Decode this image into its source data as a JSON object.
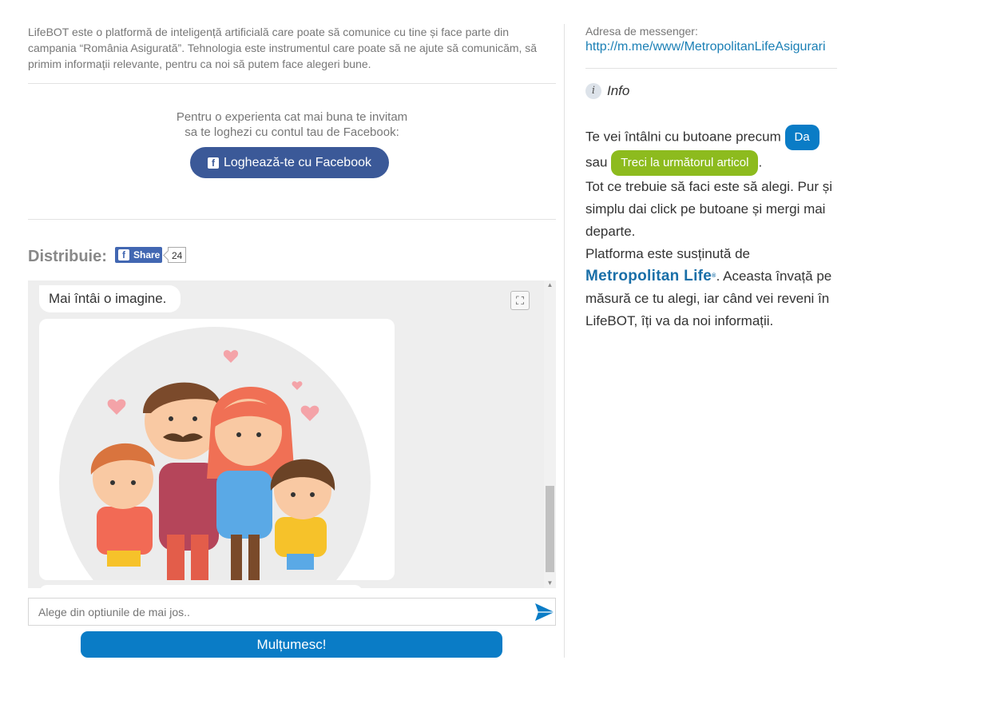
{
  "intro_text": "LifeBOT este o platformă de inteligență artificială care poate să comunice cu tine și face parte din campania “România Asigurată”. Tehnologia este instrumentul care poate să ne ajute să comunicăm, să primim informații relevante, pentru ca noi să putem face alegeri bune.",
  "login": {
    "invite_line1": "Pentru o experienta cat mai buna te invitam",
    "invite_line2": "sa te loghezi cu contul tau de Facebook:",
    "button_label": "Loghează-te cu Facebook",
    "icon": "facebook-icon"
  },
  "share": {
    "label": "Distribuie:",
    "button_label": "Share",
    "count": "24"
  },
  "chat": {
    "first_message": "Mai întâi o imagine.",
    "image_alt": "family-illustration",
    "input_placeholder": "Alege din optiunile de mai jos..",
    "reply_button": "Mulțumesc!"
  },
  "sidebar": {
    "messenger_label": "Adresa de messenger:",
    "messenger_link": "http://m.me/www/MetropolitanLifeAsigurari",
    "info_title": "Info",
    "text_1": "Te vei întâlni cu butoane precum",
    "btn_da": "Da",
    "text_sau": "sau",
    "btn_next": "Treci la următorul articol",
    "text_2": "Tot ce trebuie să faci este să alegi. Pur și simplu dai click pe butoane și mergi mai departe.",
    "text_3": "Platforma este susținută de",
    "brand": "Metropolitan Life",
    "text_4": ". Aceasta învață pe măsură ce tu alegi, iar când vei reveni în LifeBOT, îți va da noi informații."
  },
  "colors": {
    "facebook": "#3b5998",
    "primary_blue": "#0a7cc6",
    "green": "#8dbb1e",
    "brand_blue": "#1a6fa8"
  }
}
